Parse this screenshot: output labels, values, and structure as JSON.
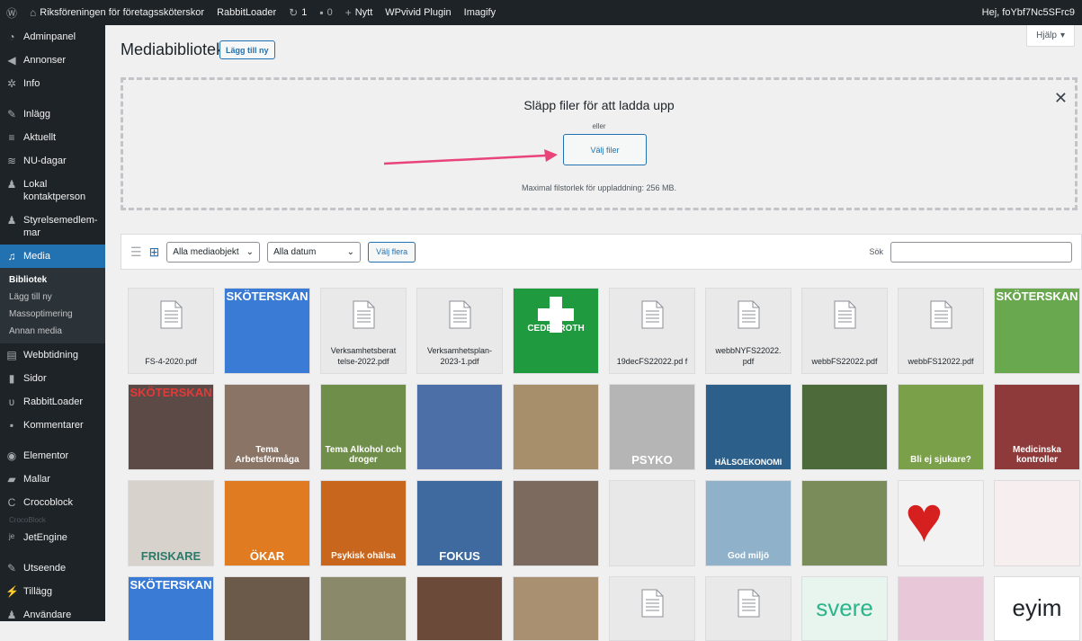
{
  "adminbar": {
    "site_name": "Riksföreningen för företagssköterskor",
    "rabbitloader": "RabbitLoader",
    "updates": "1",
    "comments": "0",
    "new": "Nytt",
    "wpvivid": "WPvivid Plugin",
    "imagify": "Imagify",
    "greeting": "Hej, foYbf7Nc5SFrc9"
  },
  "sidebar": {
    "items": [
      {
        "icon": "dashboard-icon",
        "label": "Adminpanel"
      },
      {
        "icon": "megaphone-icon",
        "label": "Annonser"
      },
      {
        "icon": "info-icon",
        "label": "Info"
      },
      {
        "icon": "pin-icon",
        "label": "Inlägg"
      },
      {
        "icon": "list-icon",
        "label": "Aktuellt"
      },
      {
        "icon": "calendar-icon",
        "label": "NU-dagar"
      },
      {
        "icon": "person-icon",
        "label": "Lokal kontaktperson"
      },
      {
        "icon": "person-icon",
        "label": "Styrelsemedlem-mar"
      },
      {
        "icon": "media-icon",
        "label": "Media"
      },
      {
        "icon": "newspaper-icon",
        "label": "Webbtidning"
      },
      {
        "icon": "page-icon",
        "label": "Sidor"
      },
      {
        "icon": "rabbit-icon",
        "label": "RabbitLoader"
      },
      {
        "icon": "comment-icon",
        "label": "Kommentarer"
      },
      {
        "icon": "elementor-icon",
        "label": "Elementor"
      },
      {
        "icon": "folder-icon",
        "label": "Mallar"
      },
      {
        "icon": "crocoblock-icon",
        "label": "Crocoblock"
      },
      {
        "icon": "jetengine-icon",
        "label": "JetEngine"
      },
      {
        "icon": "brush-icon",
        "label": "Utseende"
      },
      {
        "icon": "plugin-icon",
        "label": "Tillägg"
      },
      {
        "icon": "user-icon",
        "label": "Användare"
      }
    ],
    "media_sub": [
      "Bibliotek",
      "Lägg till ny",
      "Massoptimering",
      "Annan media"
    ],
    "crocoblock_sub": "CrocoBlock"
  },
  "main": {
    "title": "Mediabibliotek",
    "add_new": "Lägg till ny",
    "help": "Hjälp"
  },
  "uploader": {
    "drop_text": "Släpp filer för att ladda upp",
    "or": "eller",
    "select_files": "Välj filer",
    "max_size": "Maximal filstorlek för uppladdning: 256 MB."
  },
  "toolbar": {
    "filter_type": "Alla mediaobjekt",
    "filter_date": "Alla datum",
    "bulk_select": "Välj flera",
    "search_label": "Sök",
    "search_value": ""
  },
  "grid": {
    "row1": [
      {
        "type": "doc",
        "name": "FS-4-2020.pdf"
      },
      {
        "type": "image",
        "color": "#3a7bd5",
        "text": "SKÖTERSKAN"
      },
      {
        "type": "doc",
        "name": "Verksamhetsberat telse-2022.pdf"
      },
      {
        "type": "doc",
        "name": "Verksamhetsplan-2023-1.pdf"
      },
      {
        "type": "image",
        "color": "#1f9a3e",
        "text": "CEDERROTH"
      },
      {
        "type": "doc",
        "name": "19decFS22022.pd f"
      },
      {
        "type": "doc",
        "name": "webbNYFS22022. pdf"
      },
      {
        "type": "doc",
        "name": "webbFS22022.pdf"
      },
      {
        "type": "doc",
        "name": "webbFS12022.pdf"
      },
      {
        "type": "image",
        "color": "#6aa84f",
        "text": "SKÖTERSKAN"
      }
    ],
    "row2": [
      {
        "color": "#5b4a45",
        "text": "SKÖTERSKAN"
      },
      {
        "color": "#8a7466",
        "text": "Tema Arbetsförmåga"
      },
      {
        "color": "#6f8e4a",
        "text": "Tema Alkohol och droger"
      },
      {
        "color": "#4c6fa8",
        "text": ""
      },
      {
        "color": "#a88f6b",
        "text": ""
      },
      {
        "color": "#b5b5b5",
        "text": "PSYKO"
      },
      {
        "color": "#2c5f8a",
        "text": "HÄLSOEKONOMI"
      },
      {
        "color": "#4c6a3a",
        "text": ""
      },
      {
        "color": "#7aa04a",
        "text": "Bli ej sjukare?"
      },
      {
        "color": "#8e3a3a",
        "text": "Medicinska kontroller"
      }
    ],
    "row3": [
      {
        "color": "#d8d2cc",
        "text": "FRISKARE"
      },
      {
        "color": "#e07b22",
        "text": "ÖKAR"
      },
      {
        "color": "#c8661e",
        "text": "Psykisk ohälsa"
      },
      {
        "color": "#3e6aa0",
        "text": "FOKUS"
      },
      {
        "color": "#7d6a5e",
        "text": ""
      },
      {
        "color": "#e8e8e8",
        "text": ""
      },
      {
        "color": "#8fb1c9",
        "text": "God miljö"
      },
      {
        "color": "#7a8c5a",
        "text": ""
      },
      {
        "color": "#f2f2f2",
        "text": ""
      },
      {
        "color": "#f7eef0",
        "text": ""
      }
    ],
    "row4": [
      {
        "color": "#3a7bd5",
        "text": "SKÖTERSKAN"
      },
      {
        "color": "#6b5a4a",
        "text": ""
      },
      {
        "color": "#8a8a6a",
        "text": ""
      },
      {
        "color": "#6b4a3a",
        "text": ""
      },
      {
        "color": "#a89070",
        "text": ""
      },
      {
        "type": "doc"
      },
      {
        "type": "doc"
      },
      {
        "color": "#e8f4ee",
        "text": "svere"
      },
      {
        "color": "#e8c8d8",
        "text": ""
      },
      {
        "color": "#ffffff",
        "text": "eyim"
      }
    ]
  }
}
